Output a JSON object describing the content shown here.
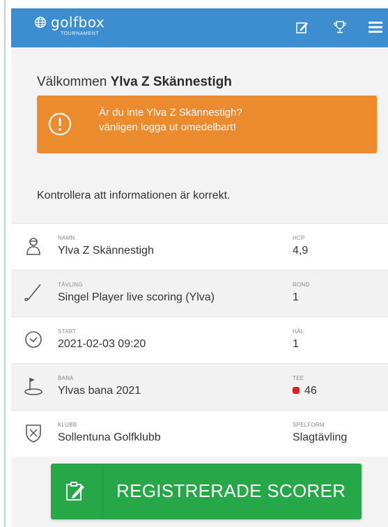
{
  "header": {
    "brand": "golfbox",
    "brand_sub": "TOURNAMENT",
    "icons": [
      "scorecard-edit-icon",
      "trophy-icon",
      "menu-icon"
    ]
  },
  "welcome": {
    "prefix": "Välkommen",
    "name": "Ylva Z Skännestigh"
  },
  "alert": {
    "icon": "exclamation-icon",
    "line1": "Är du inte Ylva Z Skännestigh?",
    "line2": "vänligen logga ut omedelbart!",
    "color": "#ec8a2e"
  },
  "check_text": "Kontrollera att informationen är korrekt.",
  "rows": [
    {
      "icon": "golfer-icon",
      "label": "NAMN",
      "value": "Ylva Z Skännestigh",
      "right_label": "HCP",
      "right_value": "4,9"
    },
    {
      "icon": "golf-club-icon",
      "label": "TÄVLING",
      "value": "Singel Player live scoring (Ylva)",
      "right_label": "ROND",
      "right_value": "1"
    },
    {
      "icon": "clock-icon",
      "label": "START",
      "value": "2021-02-03 09:20",
      "right_label": "HÅL",
      "right_value": "1"
    },
    {
      "icon": "course-flag-icon",
      "label": "BANA",
      "value": "Ylvas bana 2021",
      "right_label": "TEE",
      "right_value": "46",
      "tee_color": "#e01e1e"
    },
    {
      "icon": "club-crest-icon",
      "label": "KLUBB",
      "value": "Sollentuna Golfklubb",
      "right_label": "SPELFORM",
      "right_value": "Slagtävling"
    }
  ],
  "register_button": {
    "label": "REGISTRERADE SCORER",
    "icon": "scorecard-edit-icon",
    "color": "#27a848"
  }
}
